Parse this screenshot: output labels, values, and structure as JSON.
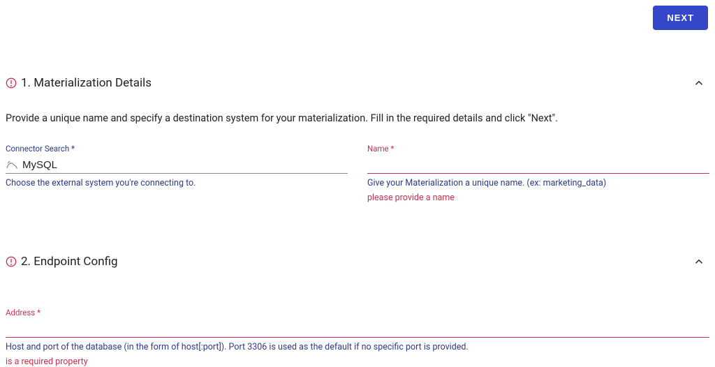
{
  "topbar": {
    "next_label": "NEXT"
  },
  "section1": {
    "title": "1. Materialization Details",
    "description": "Provide a unique name and specify a destination system for your materialization. Fill in the required details and click \"Next\".",
    "connector": {
      "label": "Connector Search *",
      "value": "MySQL",
      "helper": "Choose the external system you're connecting to."
    },
    "name": {
      "label": "Name *",
      "value": "",
      "helper": "Give your Materialization a unique name. (ex: marketing_data)",
      "error": "please provide a name"
    }
  },
  "section2": {
    "title": "2. Endpoint Config",
    "address": {
      "label": "Address *",
      "value": "",
      "helper": "Host and port of the database (in the form of host[:port]). Port 3306 is used as the default if no specific port is provided.",
      "error": "is a required property"
    }
  }
}
